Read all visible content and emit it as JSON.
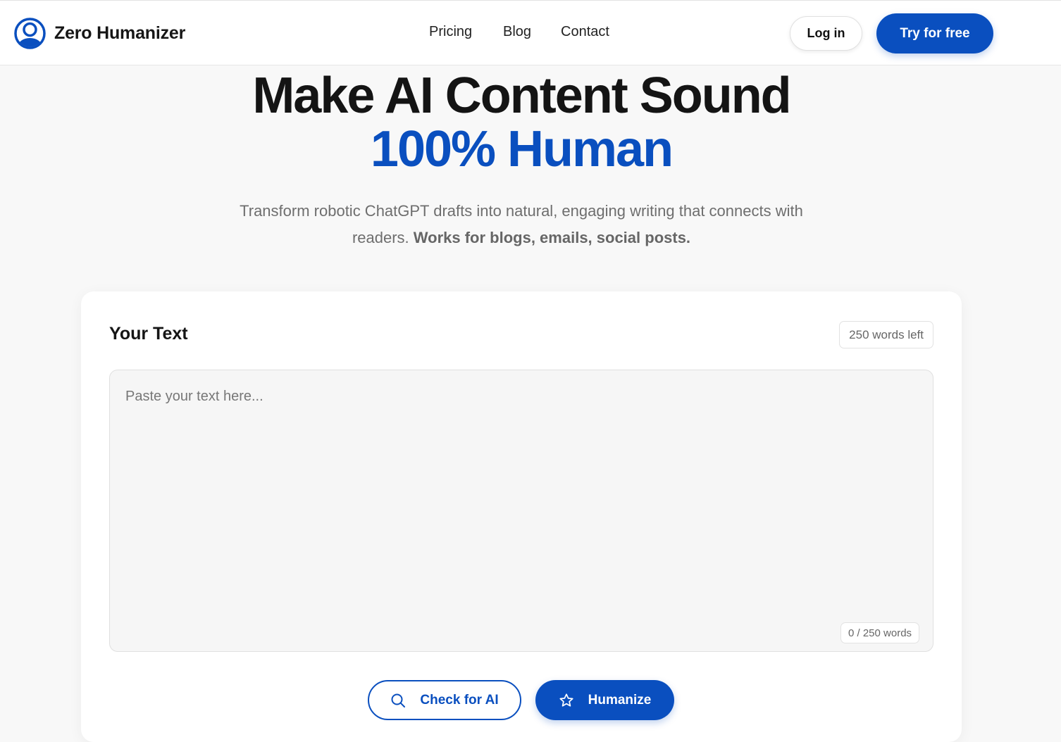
{
  "brand": {
    "name": "Zero Humanizer",
    "color": "#0a4fbf",
    "logo_icon": "person-circle-icon"
  },
  "nav": {
    "items": [
      {
        "label": "Pricing"
      },
      {
        "label": "Blog"
      },
      {
        "label": "Contact"
      }
    ],
    "login_label": "Log in",
    "try_label": "Try for free"
  },
  "hero": {
    "line1": "Make AI Content Sound",
    "line2": "100% Human",
    "subtitle_plain": "Transform robotic ChatGPT drafts into natural, engaging writing that connects with readers.",
    "subtitle_bold": "Works for blogs, emails, social posts."
  },
  "editor": {
    "title": "Your Text",
    "words_left": "250 words left",
    "placeholder": "Paste your text here...",
    "value": "",
    "word_count": "0 / 250 words"
  },
  "actions": {
    "check_label": "Check for AI",
    "check_icon": "search-icon",
    "humanize_label": "Humanize",
    "humanize_icon": "star-icon"
  }
}
